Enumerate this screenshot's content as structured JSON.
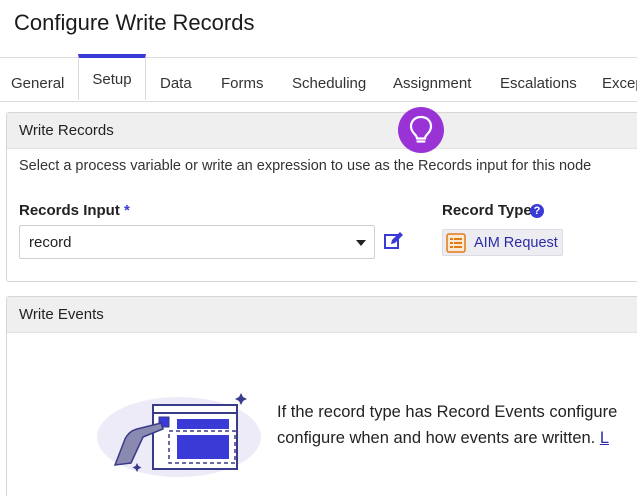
{
  "header": {
    "title": "Configure Write Records"
  },
  "tabs": [
    {
      "label": "General"
    },
    {
      "label": "Setup"
    },
    {
      "label": "Data"
    },
    {
      "label": "Forms"
    },
    {
      "label": "Scheduling"
    },
    {
      "label": "Assignment"
    },
    {
      "label": "Escalations"
    },
    {
      "label": "Excep"
    }
  ],
  "active_tab": "Setup",
  "write_records": {
    "title": "Write Records",
    "description": "Select a process variable or write an expression to use as the Records input for this node",
    "records_input_label": "Records Input",
    "required_mark": "*",
    "records_input_value": "record",
    "record_type_label": "Record Type",
    "record_type_help": "?",
    "record_type_value": "AIM Request"
  },
  "write_events": {
    "title": "Write Events",
    "line1": "If the record type has Record Events configure",
    "line2": "configure when and how events are written. ",
    "link_text": "L"
  },
  "colors": {
    "accent": "#3a3ad6",
    "hint_bulb": "#9a33d6",
    "record_icon": "#e07b1a",
    "link": "#2c2ca8"
  },
  "icons": {
    "hint": "lightbulb-icon",
    "edit": "edit-icon",
    "help": "help-icon",
    "record_type": "record-type-icon",
    "dropdown": "chevron-down-icon"
  }
}
